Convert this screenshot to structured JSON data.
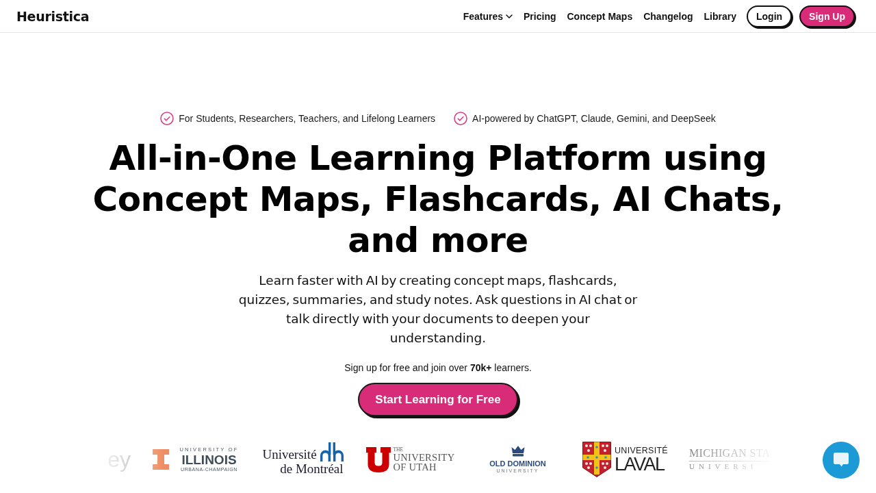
{
  "header": {
    "brand": "Heuristica",
    "nav": [
      {
        "label": "Features",
        "kind": "dropdown"
      },
      {
        "label": "Pricing",
        "kind": "link"
      },
      {
        "label": "Concept Maps",
        "kind": "link"
      },
      {
        "label": "Changelog",
        "kind": "link"
      },
      {
        "label": "Library",
        "kind": "link"
      }
    ],
    "buttons": [
      {
        "label": "Login",
        "kind": "outline"
      },
      {
        "label": "Sign Up",
        "kind": "primary"
      }
    ]
  },
  "hero": {
    "badges": [
      "For Students, Researchers, Teachers, and Lifelong Learners",
      "AI-powered by ChatGPT, Claude, Gemini, and DeepSeek"
    ],
    "title": "All-in-One Learning Platform using Concept Maps, Flashcards, AI Chats, and more",
    "description": "Learn faster with AI by creating concept maps, flashcards, quizzes, summaries, and study notes. Ask questions in AI chat or talk directly with your documents to deepen your understanding.",
    "signup_note": "Sign up for free and join over **70k+** learners.",
    "cta": "Start Learning for Free"
  },
  "logos": [
    {
      "kind": "plain",
      "lines": [
        "ey"
      ]
    },
    {
      "kind": "pillar",
      "lines": [
        "UNIVERSITY OF",
        "ILLINOIS",
        "URBANA-CHAMPAIGN"
      ]
    },
    {
      "kind": "towers",
      "lines": [
        "Université",
        "de Montréal"
      ]
    },
    {
      "kind": "block",
      "lines": [
        "THE",
        "UNIVERSITY",
        "OF UTAH"
      ]
    },
    {
      "kind": "crown",
      "lines": [
        "OLD DOMINION",
        "UNIVERSITY"
      ]
    },
    {
      "kind": "shield",
      "lines": [
        "UNIVERSITÉ",
        "LAVAL"
      ]
    },
    {
      "kind": "ruled",
      "lines": [
        "MICHIGAN STA",
        "UNIVERSI"
      ]
    }
  ]
}
